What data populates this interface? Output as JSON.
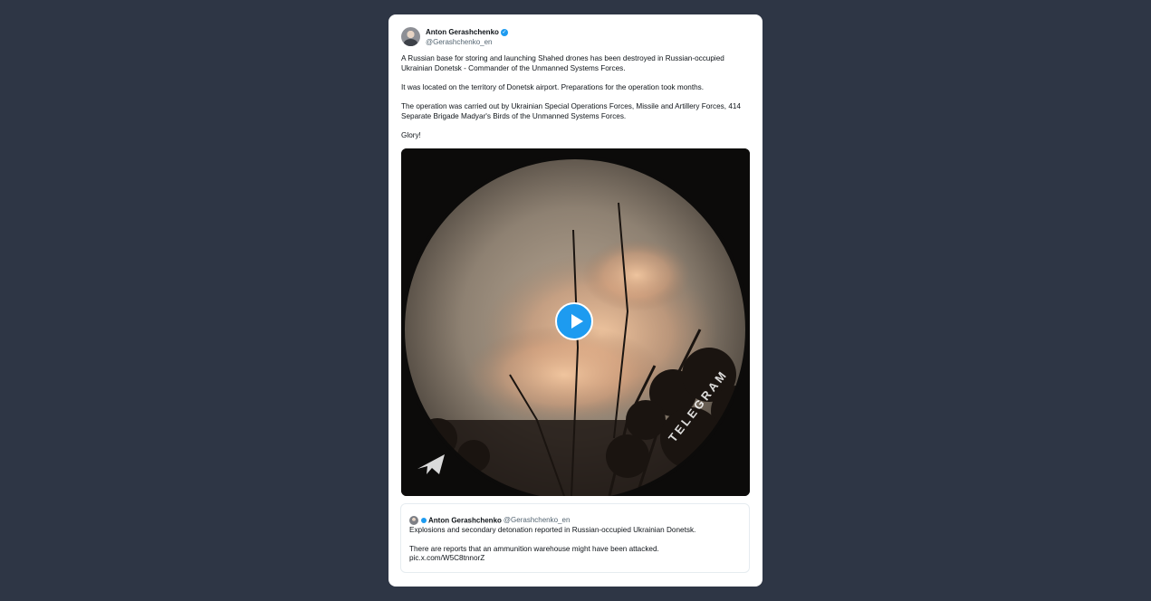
{
  "tweet": {
    "author_name": "Anton Gerashchenko",
    "handle": "@Gerashchenko_en",
    "paragraphs": [
      "A Russian base for storing and launching Shahed drones has been destroyed in Russian-occupied Ukrainian Donetsk - Commander of the Unmanned Systems Forces.",
      "It was located on the territory of Donetsk airport. Preparations for the operation took months.",
      "The operation was carried out by Ukrainian Special Operations Forces, Missile and Artillery Forces, 414 Separate Brigade Madyar's Birds of the Unmanned Systems Forces.",
      "Glory!"
    ]
  },
  "media": {
    "watermark": "TELEGRAM",
    "play_icon": "play-icon",
    "watermark_icon": "telegram-plane-icon"
  },
  "quoted_tweet": {
    "author_name": "Anton Gerashchenko",
    "handle": "@Gerashchenko_en",
    "line1": "Explosions and secondary detonation reported in Russian-occupied Ukrainian Donetsk.",
    "line2": "There are reports that an ammunition warehouse might have been attacked.",
    "link": "pic.x.com/W5C8tnnorZ"
  },
  "colors": {
    "page_background": "#2e3645",
    "card_background": "#ffffff",
    "accent": "#1d9bf0",
    "secondary_text": "#536471"
  }
}
